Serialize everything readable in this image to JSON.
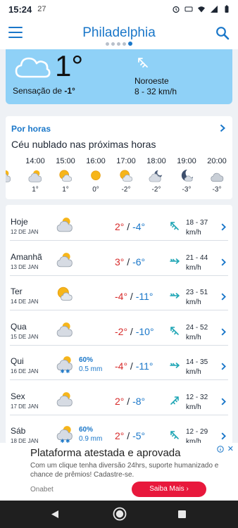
{
  "status": {
    "time": "15:24",
    "temp": "27"
  },
  "header": {
    "city": "Philadelphia",
    "page_dots": 5,
    "active_dot": 4
  },
  "current": {
    "temp": "1°",
    "feel_label": "Sensação de ",
    "feel_value": "-1°",
    "wind_dir": "Noroeste",
    "wind_speed": "8 - 32 km/h",
    "icon": "cloud-icon"
  },
  "hourly": {
    "title": "Por horas",
    "summary": "Céu nublado nas próximas horas",
    "hours": [
      {
        "time": "",
        "temp": "",
        "icon": "partly-cloudy-icon"
      },
      {
        "time": "14:00",
        "temp": "1°",
        "icon": "partly-cloudy-icon"
      },
      {
        "time": "15:00",
        "temp": "1°",
        "icon": "sun-cloud-icon"
      },
      {
        "time": "16:00",
        "temp": "0°",
        "icon": "sun-icon"
      },
      {
        "time": "17:00",
        "temp": "-2°",
        "icon": "sun-cloud-icon"
      },
      {
        "time": "18:00",
        "temp": "-2°",
        "icon": "moon-cloud-icon"
      },
      {
        "time": "19:00",
        "temp": "-3°",
        "icon": "moon-icon"
      },
      {
        "time": "20:00",
        "temp": "-3°",
        "icon": "cloud-icon"
      }
    ]
  },
  "daily": [
    {
      "name": "Hoje",
      "date": "12 DE JAN",
      "icon": "partly-cloudy-icon",
      "prob": "",
      "mm": "",
      "max": "2°",
      "min": "-4°",
      "wind": "18 - 37",
      "unit": "km/h",
      "wind_dir": "nw"
    },
    {
      "name": "Amanhã",
      "date": "13 DE JAN",
      "icon": "partly-cloudy-icon",
      "prob": "",
      "mm": "",
      "max": "3°",
      "min": "-6°",
      "wind": "21 - 44",
      "unit": "km/h",
      "wind_dir": "e"
    },
    {
      "name": "Ter",
      "date": "14 DE JAN",
      "icon": "sun-cloud-icon",
      "prob": "",
      "mm": "",
      "max": "-4°",
      "min": "-11°",
      "wind": "23 - 51",
      "unit": "km/h",
      "wind_dir": "e"
    },
    {
      "name": "Qua",
      "date": "15 DE JAN",
      "icon": "partly-cloudy-icon",
      "prob": "",
      "mm": "",
      "max": "-2°",
      "min": "-10°",
      "wind": "24 - 52",
      "unit": "km/h",
      "wind_dir": "nw"
    },
    {
      "name": "Qui",
      "date": "16 DE JAN",
      "icon": "snow-icon",
      "prob": "60%",
      "mm": "0.5 mm",
      "max": "-4°",
      "min": "-11°",
      "wind": "14 - 35",
      "unit": "km/h",
      "wind_dir": "e"
    },
    {
      "name": "Sex",
      "date": "17 DE JAN",
      "icon": "partly-cloudy-icon",
      "prob": "",
      "mm": "",
      "max": "2°",
      "min": "-8°",
      "wind": "12 - 32",
      "unit": "km/h",
      "wind_dir": "ne"
    },
    {
      "name": "Sáb",
      "date": "18 DE JAN",
      "icon": "snow-icon",
      "prob": "60%",
      "mm": "0.9 mm",
      "max": "2°",
      "min": "-5°",
      "wind": "12 - 29",
      "unit": "km/h",
      "wind_dir": "nw"
    }
  ],
  "ad": {
    "title": "Plataforma atestada e aprovada",
    "text": "Com um clique tenha diversão 24hrs, suporte humanizado e chance de prêmios! Cadastre-se.",
    "brand": "Onabet",
    "cta": "Saiba Mais ›",
    "close": "✕"
  },
  "colors": {
    "accent": "#1a77c9",
    "hero_bg": "#8fd1f7",
    "max_temp": "#d72b2b",
    "min_temp": "#1a77c9",
    "ad_cta": "#e8183c"
  }
}
